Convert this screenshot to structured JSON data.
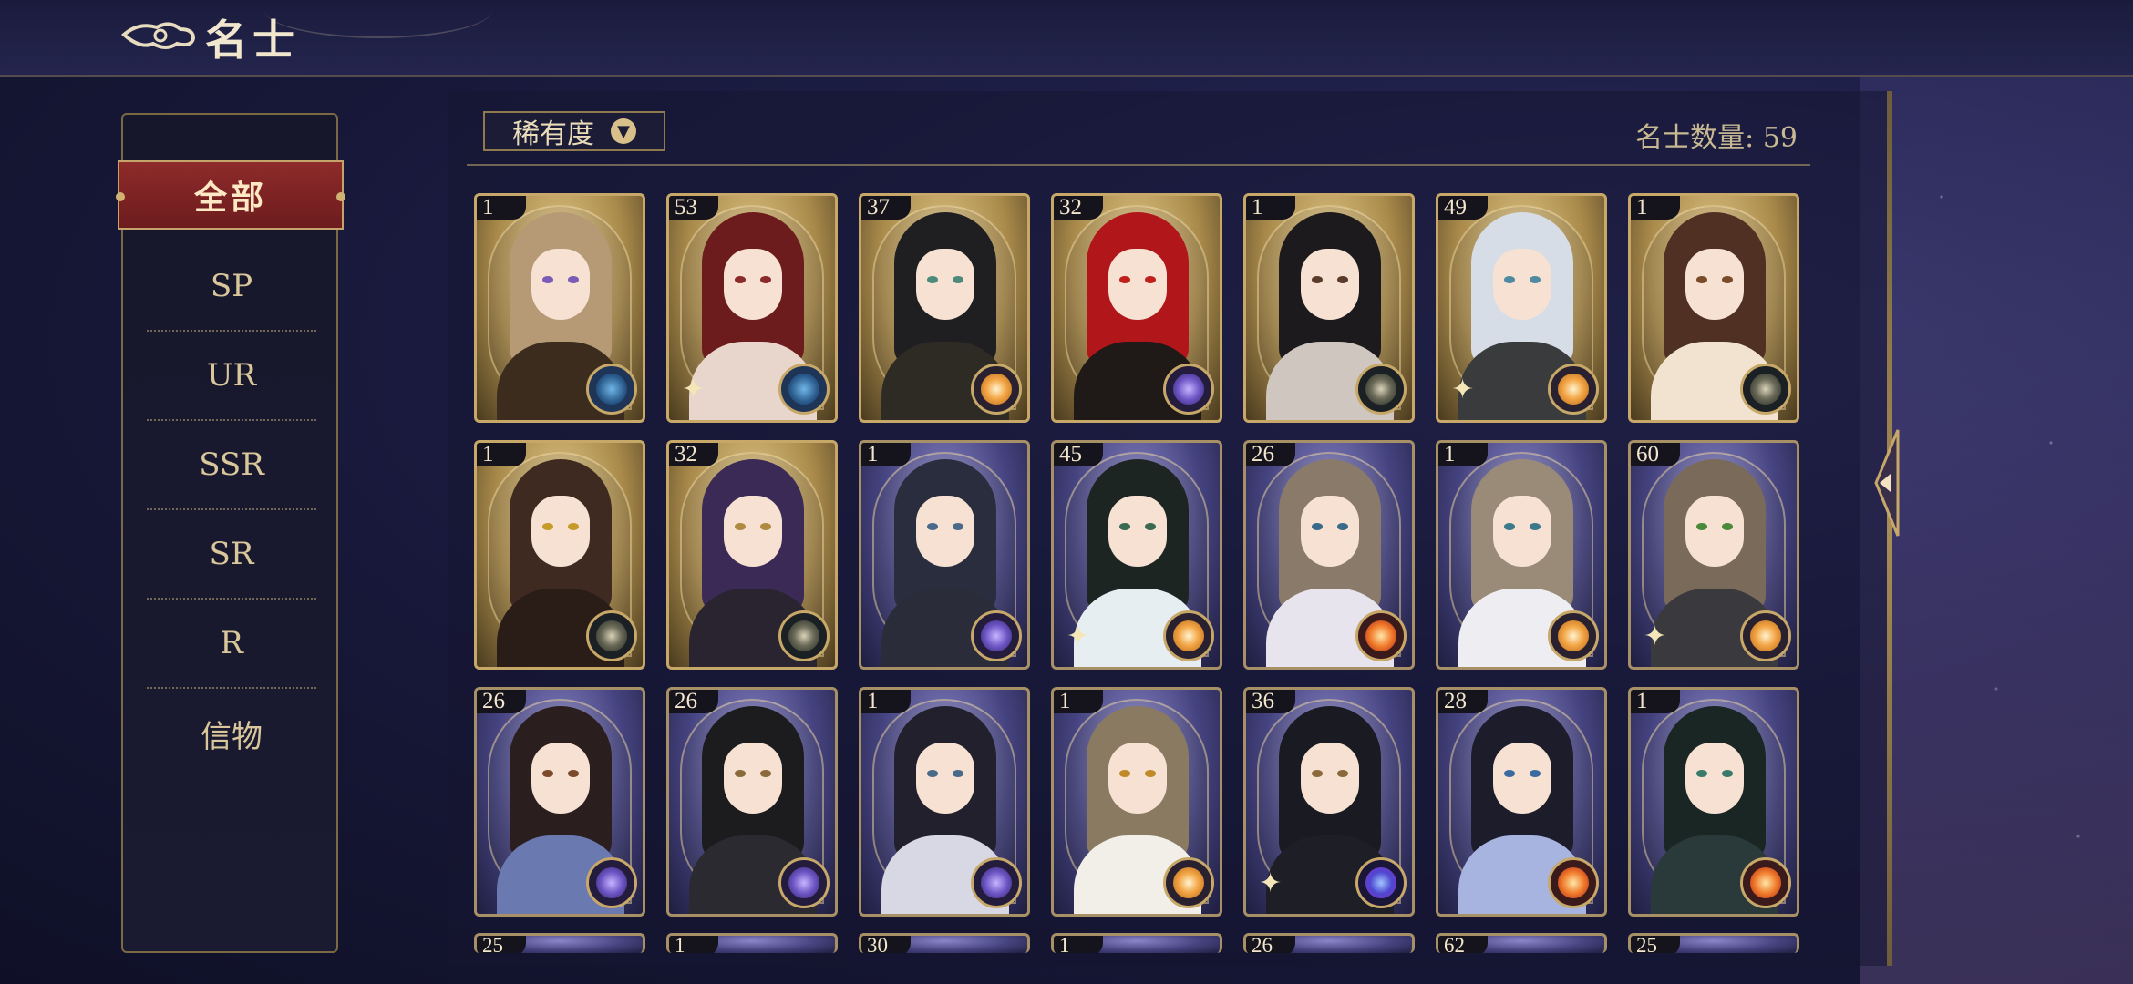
{
  "header": {
    "title": "名士",
    "back_icon": "cloud-back-icon"
  },
  "filters": {
    "active": "全部",
    "items": [
      {
        "label": "SP"
      },
      {
        "label": "UR"
      },
      {
        "label": "SSR"
      },
      {
        "label": "SR"
      },
      {
        "label": "R"
      },
      {
        "label": "信物"
      }
    ]
  },
  "sort": {
    "label": "稀有度",
    "icon": "chevron-down-icon"
  },
  "count": {
    "label": "名士数量: 59"
  },
  "colors": {
    "gold_frame": "#c7a868",
    "active_tab": "#8e2a2a",
    "panel": "#17172c"
  },
  "cards": [
    {
      "level": "1",
      "bg": "gold",
      "hair": "#b59a75",
      "eye": "#7b5bb5",
      "outfit": "#3b2c1d",
      "element": "blue",
      "sparkle": ""
    },
    {
      "level": "53",
      "bg": "gold",
      "hair": "#6c1c1c",
      "eye": "#8a2a2a",
      "outfit": "#e8d6cc",
      "element": "blue",
      "sparkle": "✦"
    },
    {
      "level": "37",
      "bg": "gold",
      "hair": "#1f1f22",
      "eye": "#4e8a7c",
      "outfit": "#2e2a24",
      "element": "orange",
      "sparkle": ""
    },
    {
      "level": "32",
      "bg": "gold",
      "hair": "#b0161a",
      "eye": "#c0201c",
      "outfit": "#1f1a18",
      "element": "violet",
      "sparkle": ""
    },
    {
      "level": "1",
      "bg": "gold",
      "hair": "#1c1a1d",
      "eye": "#5a3b2a",
      "outfit": "#cfc6c0",
      "element": "dark",
      "sparkle": ""
    },
    {
      "level": "49",
      "bg": "gold",
      "hair": "#d7dde6",
      "eye": "#4e8aa0",
      "outfit": "#3a3b3d",
      "element": "orange",
      "sparkle": "✦"
    },
    {
      "level": "1",
      "bg": "gold",
      "hair": "#4f3023",
      "eye": "#7a4b2a",
      "outfit": "#f2e3d0",
      "element": "dark",
      "sparkle": ""
    },
    {
      "level": "1",
      "bg": "gold",
      "hair": "#3e2a20",
      "eye": "#c79b2a",
      "outfit": "#2a1c17",
      "element": "dark",
      "sparkle": ""
    },
    {
      "level": "32",
      "bg": "gold",
      "hair": "#3a2a55",
      "eye": "#b08a40",
      "outfit": "#2a2430",
      "element": "dark",
      "sparkle": ""
    },
    {
      "level": "1",
      "bg": "purple",
      "hair": "#2a2d3d",
      "eye": "#4a6a8a",
      "outfit": "#2a2c3a",
      "element": "violet",
      "sparkle": ""
    },
    {
      "level": "45",
      "bg": "purple",
      "hair": "#1c2522",
      "eye": "#3a6a52",
      "outfit": "#e6eef2",
      "element": "orange",
      "sparkle": "✦"
    },
    {
      "level": "26",
      "bg": "purple",
      "hair": "#8a7a6a",
      "eye": "#3a6a8a",
      "outfit": "#e8e4ee",
      "element": "red",
      "sparkle": ""
    },
    {
      "level": "1",
      "bg": "purple",
      "hair": "#9a8a78",
      "eye": "#3a7a8a",
      "outfit": "#eeeef2",
      "element": "orange",
      "sparkle": ""
    },
    {
      "level": "60",
      "bg": "purple",
      "hair": "#7a6a5a",
      "eye": "#4a8a3a",
      "outfit": "#3a3a3e",
      "element": "orange",
      "sparkle": "✦"
    },
    {
      "level": "26",
      "bg": "purple",
      "hair": "#2a1e1e",
      "eye": "#7a4a2a",
      "outfit": "#6a7ab0",
      "element": "violet",
      "sparkle": ""
    },
    {
      "level": "26",
      "bg": "purple",
      "hair": "#1c1c1e",
      "eye": "#8a6a3a",
      "outfit": "#2a2a30",
      "element": "violet",
      "sparkle": ""
    },
    {
      "level": "1",
      "bg": "purple",
      "hair": "#22202c",
      "eye": "#4a6a8a",
      "outfit": "#d8d8e4",
      "element": "violet",
      "sparkle": ""
    },
    {
      "level": "1",
      "bg": "purple",
      "hair": "#8a7a62",
      "eye": "#c08a2a",
      "outfit": "#f2eee8",
      "element": "orange",
      "sparkle": ""
    },
    {
      "level": "36",
      "bg": "purple",
      "hair": "#1a1a22",
      "eye": "#8a6a3a",
      "outfit": "#1e1e26",
      "element": "cosmic",
      "sparkle": "✦"
    },
    {
      "level": "28",
      "bg": "purple",
      "hair": "#1c1c2a",
      "eye": "#3a6aa0",
      "outfit": "#a8b4e0",
      "element": "red",
      "sparkle": ""
    },
    {
      "level": "1",
      "bg": "purple",
      "hair": "#1a2624",
      "eye": "#3a7a6a",
      "outfit": "#2a3a3a",
      "element": "red",
      "sparkle": ""
    }
  ],
  "next_row": [
    {
      "level": "25"
    },
    {
      "level": "1"
    },
    {
      "level": "30"
    },
    {
      "level": "1"
    },
    {
      "level": "26"
    },
    {
      "level": "62"
    },
    {
      "level": "25"
    }
  ]
}
